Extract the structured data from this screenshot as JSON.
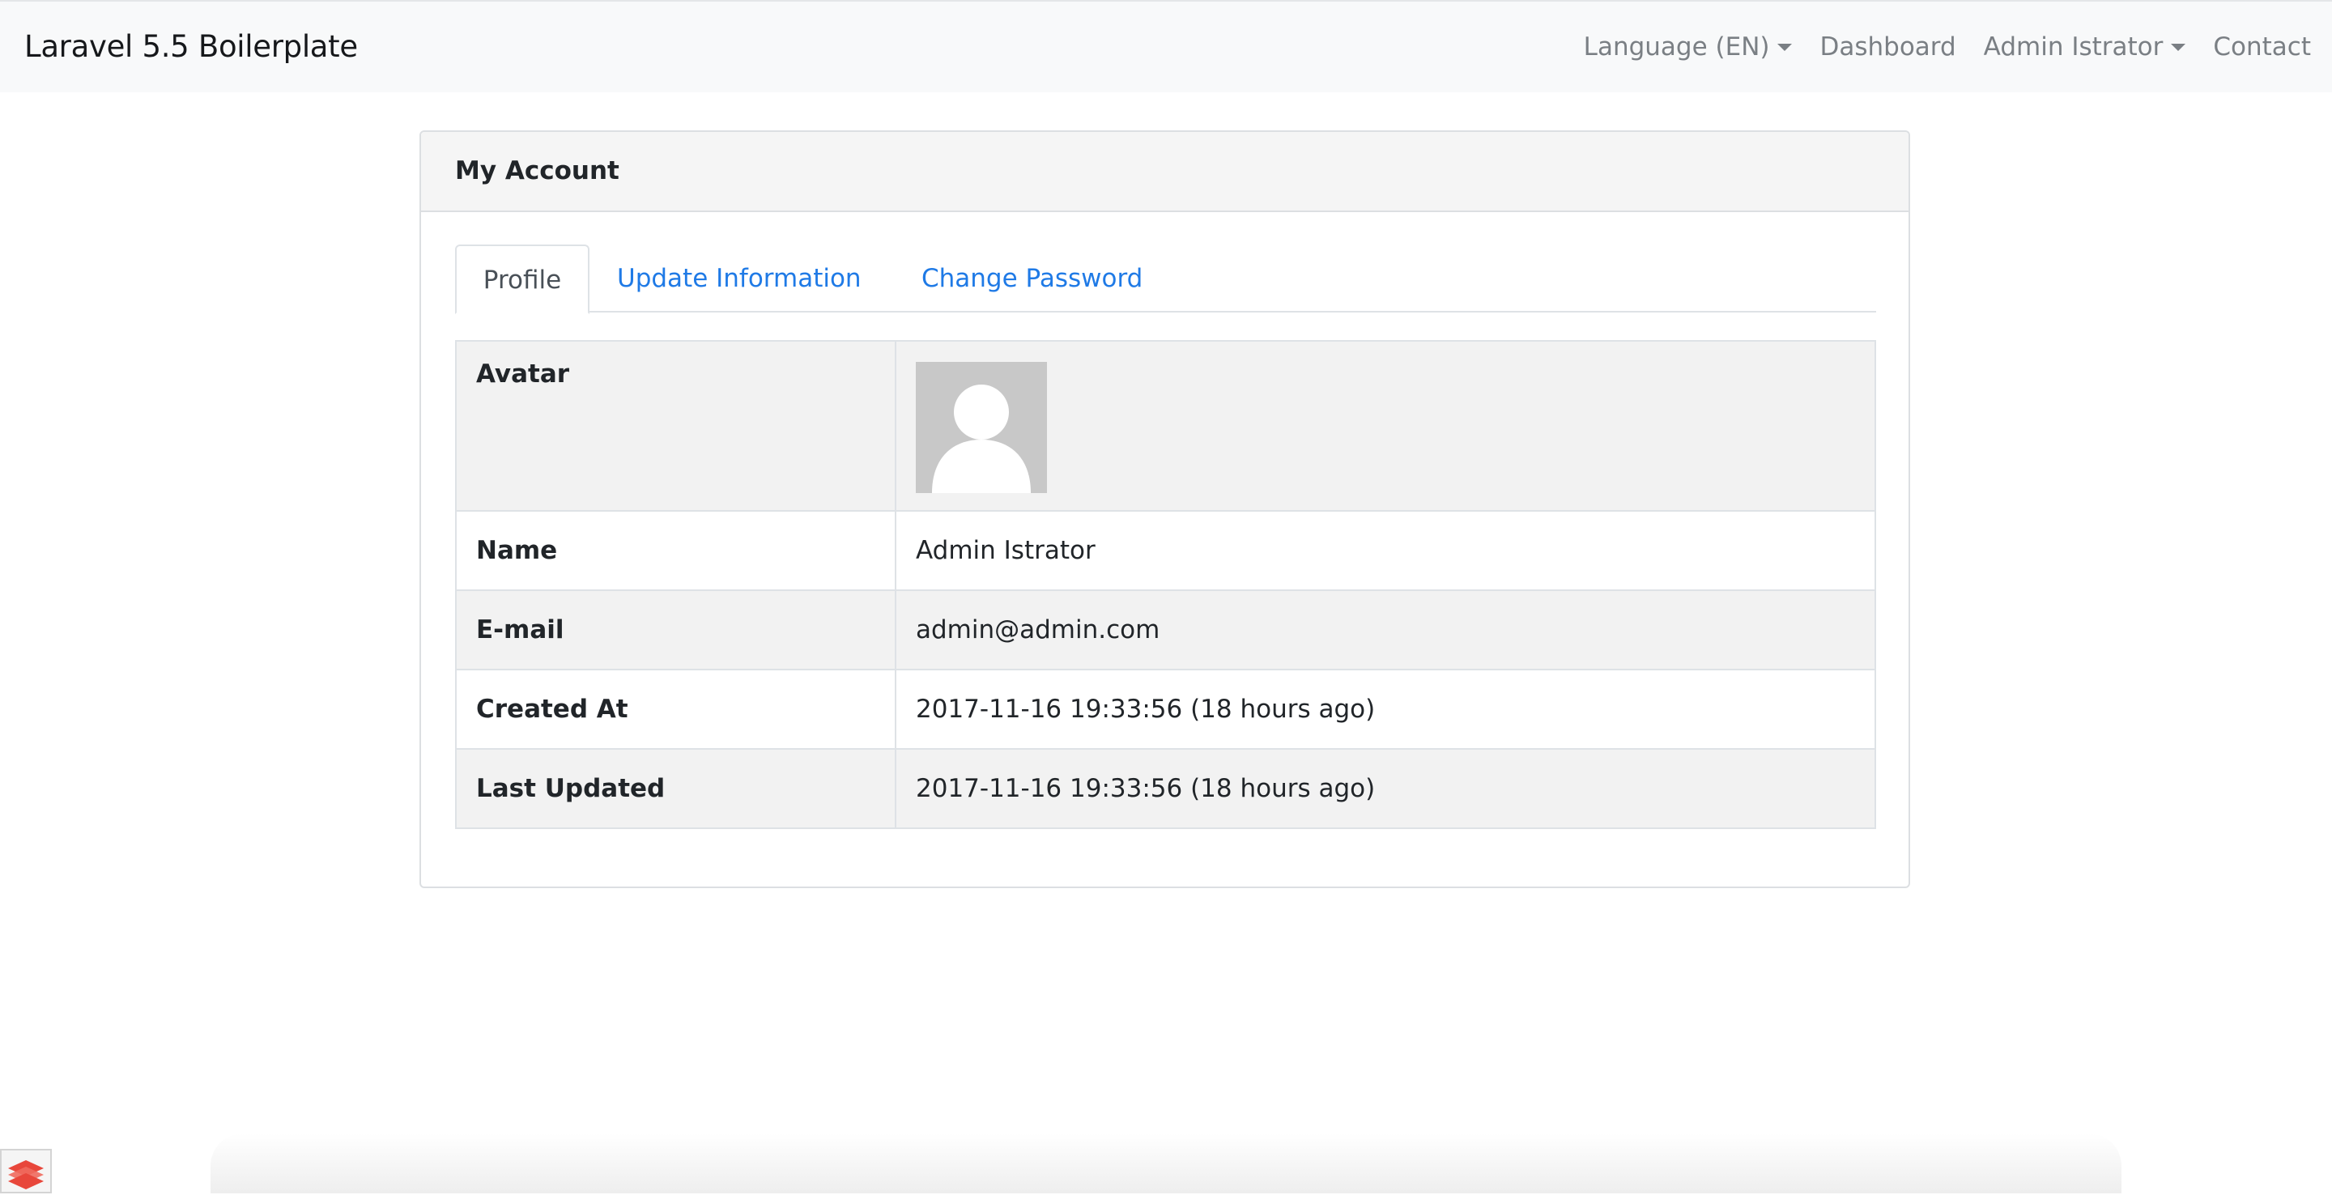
{
  "navbar": {
    "brand": "Laravel 5.5 Boilerplate",
    "links": {
      "language": "Language (EN)",
      "dashboard": "Dashboard",
      "user": "Admin Istrator",
      "contact": "Contact"
    }
  },
  "card": {
    "title": "My Account",
    "tabs": {
      "profile": "Profile",
      "update_information": "Update Information",
      "change_password": "Change Password"
    },
    "rows": {
      "avatar": {
        "label": "Avatar"
      },
      "name": {
        "label": "Name",
        "value": "Admin Istrator"
      },
      "email": {
        "label": "E-mail",
        "value": "admin@admin.com"
      },
      "created_at": {
        "label": "Created At",
        "value": "2017-11-16 19:33:56 (18 hours ago)"
      },
      "last_updated": {
        "label": "Last Updated",
        "value": "2017-11-16 19:33:56 (18 hours ago)"
      }
    }
  },
  "colors": {
    "navbar_bg": "#f8f9fa",
    "link": "#1f7ae6",
    "nav_text": "#7a7f84",
    "card_header_bg": "#f5f5f5",
    "stripe": "#f2f2f2",
    "debug_icon": "#e8473b"
  }
}
